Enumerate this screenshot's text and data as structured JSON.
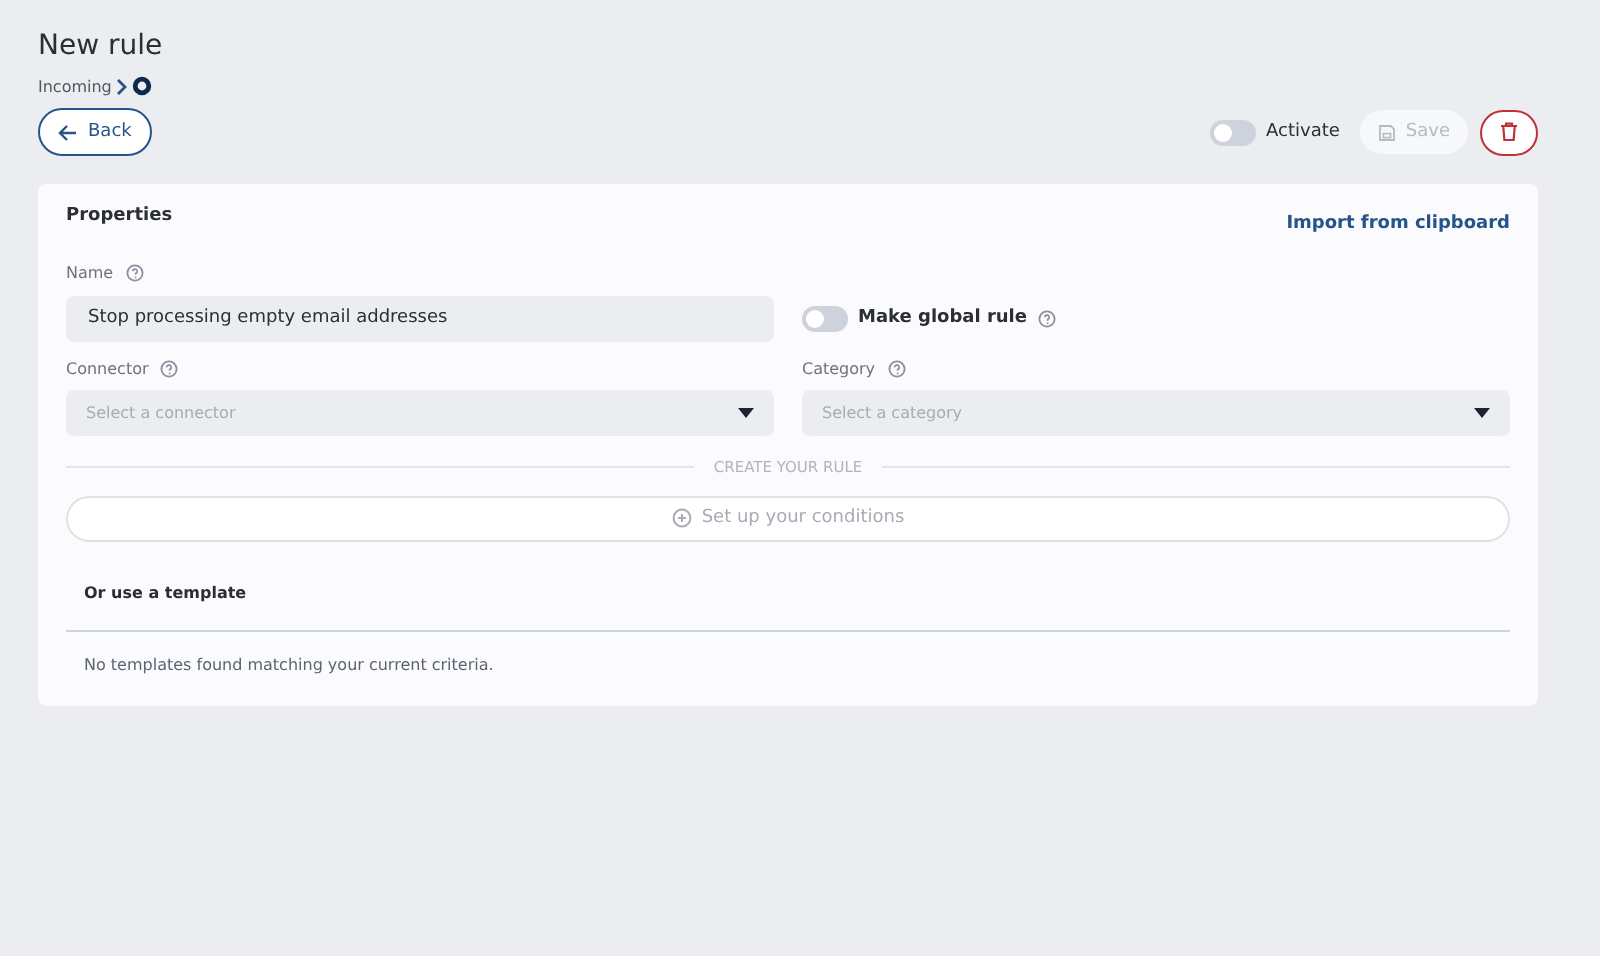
{
  "page": {
    "title": "New rule",
    "breadcrumb": "Incoming"
  },
  "toolbar": {
    "back": "Back",
    "activate": {
      "label": "Activate",
      "on": false
    },
    "save": {
      "label": "Save",
      "disabled": true
    }
  },
  "properties": {
    "title": "Properties",
    "import": "Import from clipboard",
    "name": {
      "label": "Name",
      "value": "Stop processing empty email addresses"
    },
    "global": {
      "label": "Make global rule",
      "on": false
    },
    "connector": {
      "label": "Connector",
      "placeholder": "Select a connector"
    },
    "category": {
      "label": "Category",
      "placeholder": "Select a category"
    },
    "divider": "CREATE YOUR RULE",
    "conditions": "Set up your conditions",
    "template_title": "Or use a template",
    "template_empty": "No templates found matching your current criteria."
  }
}
